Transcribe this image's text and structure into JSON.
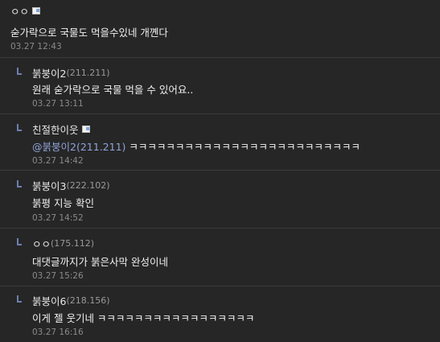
{
  "comments": [
    {
      "author": "ㅇㅇ",
      "ip": "",
      "has_badge": true,
      "mention": "",
      "body": "숟가락으로 국물도 먹을수있네 개꼔다",
      "date": "03.27 12:43"
    },
    {
      "author": "붉붕이2",
      "ip": "(211.211)",
      "has_badge": false,
      "mention": "",
      "body": "원래 숟가락으로 국물 먹을 수 있어요..",
      "date": "03.27 13:11"
    },
    {
      "author": "친절한이웃",
      "ip": "",
      "has_badge": true,
      "mention": "@붉붕이2(211.211)",
      "body": " ㅋㅋㅋㅋㅋㅋㅋㅋㅋㅋㅋㅋㅋㅋㅋㅋㅋㅋㅋㅋㅋㅋㅋㅋㅋ",
      "date": "03.27 14:42"
    },
    {
      "author": "붉붕이3",
      "ip": "(222.102)",
      "has_badge": false,
      "mention": "",
      "body": "붉평 지능 확인",
      "date": "03.27 14:52"
    },
    {
      "author": "ㅇㅇ",
      "ip": "(175.112)",
      "has_badge": false,
      "mention": "",
      "body": "대댓글까지가 붉은사막 완성이네",
      "date": "03.27 15:26"
    },
    {
      "author": "붉붕이6",
      "ip": "(218.156)",
      "has_badge": false,
      "mention": "",
      "body": "이게 젤 웃기네 ㅋㅋㅋㅋㅋㅋㅋㅋㅋㅋㅋㅋㅋㅋㅋㅋㅋ",
      "date": "03.27 16:16"
    }
  ],
  "colors": {
    "background": "#262626",
    "divider": "#3a3a3a",
    "reply_mark": "#6e7fb0",
    "mention": "#8fa3d8",
    "date": "#8a8a8a"
  }
}
